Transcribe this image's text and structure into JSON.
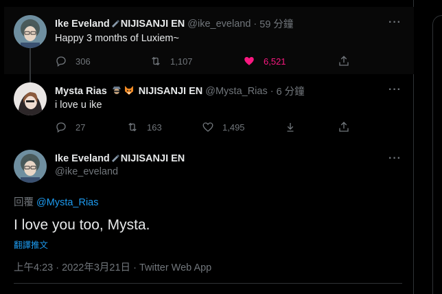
{
  "tweets": [
    {
      "display_name": "Ike Eveland",
      "org": "NIJISANJI EN",
      "handle": "@ike_eveland",
      "time": "59 分鐘",
      "text": "Happy 3 months of Luxiem~",
      "replies": "306",
      "retweets": "1,107",
      "likes": "6,521",
      "liked": true
    },
    {
      "display_name": "Mysta Rias",
      "org": "NIJISANJI EN",
      "handle": "@Mysta_Rias",
      "time": "6 分鐘",
      "text": "i love u ike",
      "replies": "27",
      "retweets": "163",
      "likes": "1,495",
      "liked": false
    }
  ],
  "main_tweet": {
    "display_name": "Ike Eveland",
    "org": "NIJISANJI EN",
    "handle": "@ike_eveland",
    "reply_prefix": "回覆",
    "reply_mention": "@Mysta_Rias",
    "text": "I love you too, Mysta.",
    "translate": "翻譯推文",
    "timestamp": "上午4:23 · 2022年3月21日 · Twitter Web App"
  },
  "separator": "·",
  "more_label": "···",
  "icons": {
    "reply": "reply-icon",
    "retweet": "retweet-icon",
    "like": "heart-icon",
    "share": "share-icon",
    "more": "more-icon",
    "pen": "pen-emoji",
    "detective": "detective-emoji",
    "fox": "fox-emoji"
  },
  "colors": {
    "background": "#000000",
    "text": "#e7e9ea",
    "muted": "#71767b",
    "link": "#1d9bf0",
    "like": "#f91880"
  }
}
